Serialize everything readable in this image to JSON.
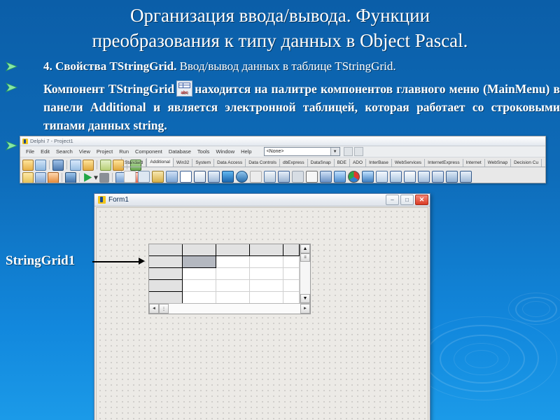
{
  "slide": {
    "title_line1": "Организация ввода/вывода.  Функции",
    "title_line2": "преобразования к типу данных в Object Pascal.",
    "bullet1_bold": "4. Свойства TStringGrid.",
    "bullet1_rest": " Ввод/вывод данных в таблице TStringGrid.",
    "bullet2_part1": "Компонент TStringGrid",
    "bullet2_part2": "находится на палитре компонентов главного меню (MainMenu) в панели Additional и является электронной таблицей, которая работает со строковыми типами данных string.",
    "callout_label": "StringGrid1",
    "bullet_icon": "green-arrow-bullet",
    "inline_icon": "tstringgrid-component-icon",
    "inline_icon_text": "abc",
    "colors": {
      "background_top": "#0b5ea8",
      "background_bottom": "#1b9ae8",
      "title_text": "#ffffff",
      "bullet_arrow": "#7fe3a0"
    }
  },
  "ide": {
    "window_title": "Delphi 7 - Project1",
    "app_icon": "delphi-logo-icon",
    "menu": [
      "File",
      "Edit",
      "Search",
      "View",
      "Project",
      "Run",
      "Component",
      "Database",
      "Tools",
      "Window",
      "Help"
    ],
    "combo_value": "<None>",
    "combo_icon": "chevron-down-icon",
    "palette_tabs": [
      "Standard",
      "Additional",
      "Win32",
      "System",
      "Data Access",
      "Data Controls",
      "dbExpress",
      "DataSnap",
      "BDE",
      "ADO",
      "InterBase",
      "WebServices",
      "InternetExpress",
      "Internet",
      "WebSnap",
      "Decision Cu"
    ],
    "active_tab": "Additional",
    "toolbar_icons": [
      "open-project-icon",
      "open-icon",
      "dropdown-icon",
      "save-icon",
      "save-all-icon",
      "open-file-icon",
      "add-to-project-icon",
      "remove-from-project-icon",
      "help-icon",
      "new-form-icon",
      "toggle-form-unit-icon",
      "new-unit-icon",
      "view-unit-icon",
      "run-icon",
      "run-dropdown-icon",
      "pause-icon",
      "trace-into-icon",
      "step-over-icon"
    ],
    "palette_icons": [
      "pointer-icon",
      "frames-icon",
      "bitbtn-icon",
      "speedbutton-icon",
      "maskedit-icon",
      "stringgrid-icon",
      "drawgrid-icon",
      "image-icon",
      "shape-icon",
      "bevel-icon",
      "scrollbox-icon",
      "checklistbox-icon",
      "splitter-icon",
      "staticext-icon",
      "control-bar-icon",
      "applicationevents-icon",
      "chart-icon",
      "actionlist-icon",
      "labeledit-icon",
      "colorbox-icon",
      "valuelisteditor-icon",
      "treeview-icon",
      "listview-icon",
      "gridpanel-icon",
      "categorypanel-icon"
    ]
  },
  "form": {
    "title": "Form1",
    "icon": "delphi-form-icon",
    "minimize": "–",
    "maximize": "□",
    "close": "✕",
    "grid": {
      "name": "StringGrid1",
      "fixed_cols": 1,
      "fixed_rows": 1,
      "visible_cols": 5,
      "visible_rows": 5,
      "selected_cell": "row1-col1",
      "vscroll_up": "▲",
      "vscroll_down": "▼",
      "hscroll_left": "◄",
      "hscroll_right": "►"
    }
  }
}
